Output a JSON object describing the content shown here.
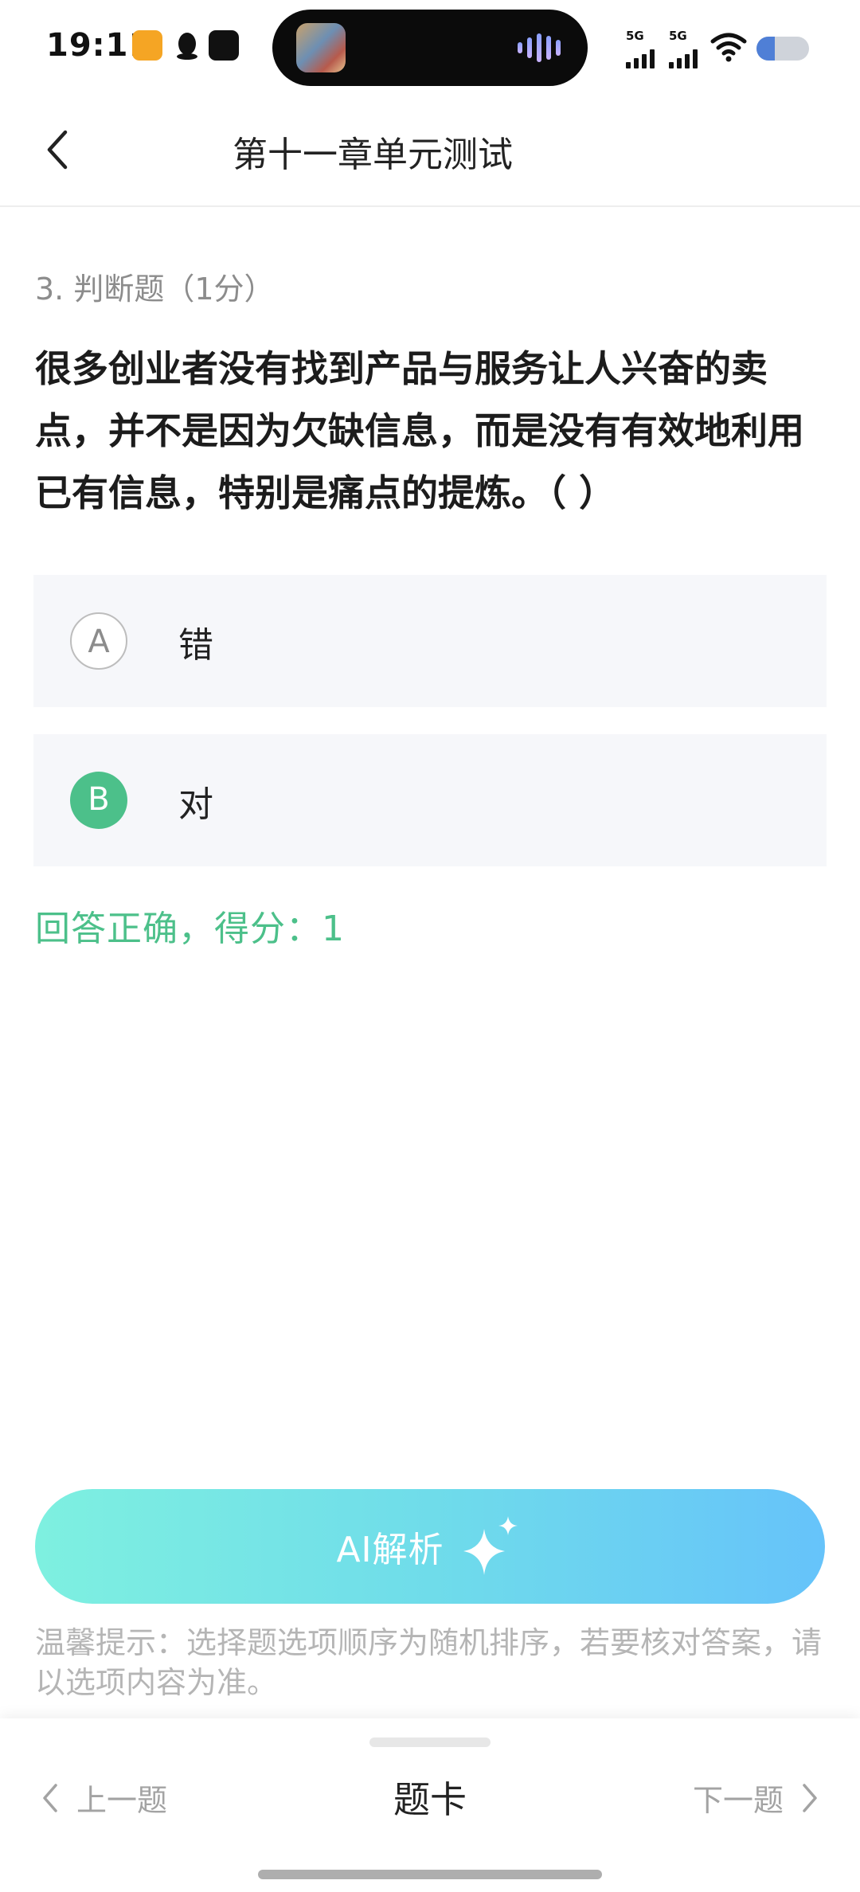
{
  "status_bar": {
    "time": "19:11",
    "network_1": "5G",
    "network_2": "5G",
    "battery_level": 0.35
  },
  "header": {
    "title": "第十一章单元测试"
  },
  "question": {
    "meta": "3. 判断题（1分）",
    "text": "很多创业者没有找到产品与服务让人兴奋的卖点，并不是因为欠缺信息，而是没有有效地利用已有信息，特别是痛点的提炼。（ ）",
    "options": [
      {
        "letter": "A",
        "text": "错",
        "selected": false
      },
      {
        "letter": "B",
        "text": "对",
        "selected": true
      }
    ],
    "result": "回答正确，得分：1"
  },
  "ai_button": {
    "label": "AI解析"
  },
  "tip": "温馨提示：选择题选项顺序为随机排序，若要核对答案，请以选项内容为准。",
  "bottom_bar": {
    "prev_label": "上一题",
    "card_label": "题卡",
    "next_label": "下一题"
  },
  "colors": {
    "accent_green": "#4cc08a",
    "ai_gradient_start": "#7ef0e0",
    "ai_gradient_end": "#66c3fa"
  }
}
